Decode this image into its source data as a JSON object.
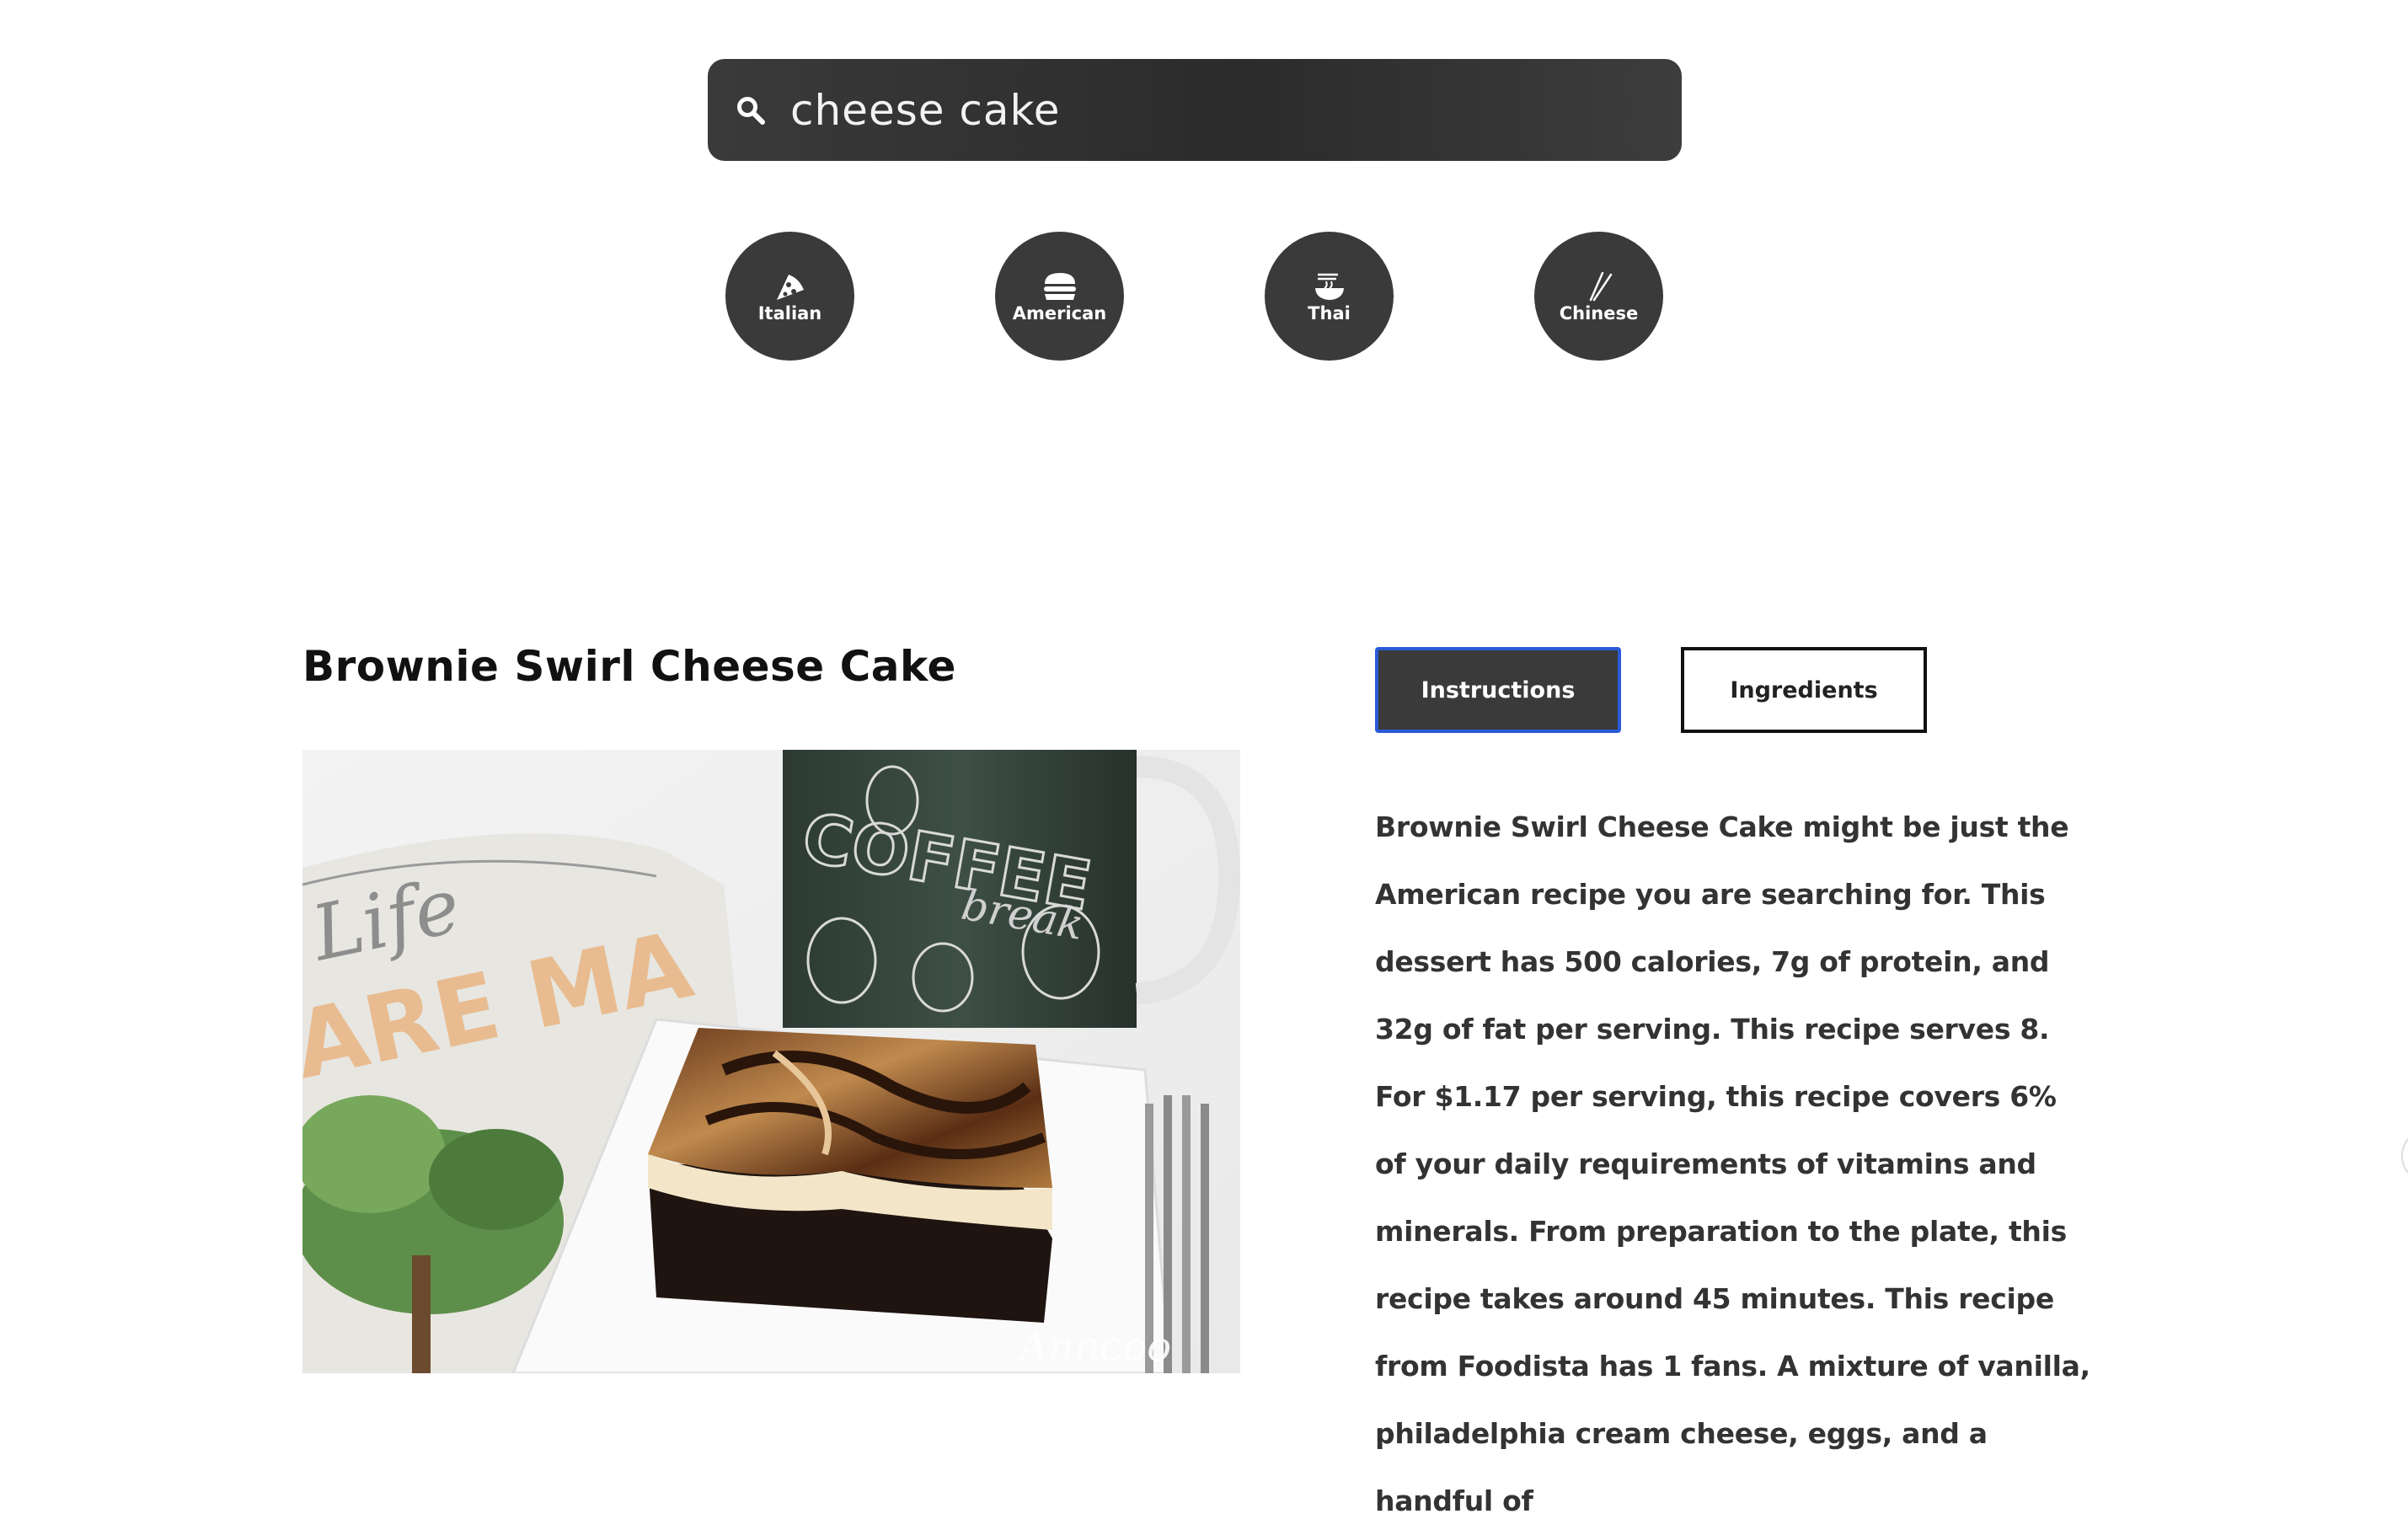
{
  "search": {
    "value": "cheese cake",
    "icon": "search-icon"
  },
  "cuisines": [
    {
      "label": "Italian",
      "icon": "pizza-icon"
    },
    {
      "label": "American",
      "icon": "burger-icon"
    },
    {
      "label": "Thai",
      "icon": "noodle-bowl-icon"
    },
    {
      "label": "Chinese",
      "icon": "chopsticks-icon"
    }
  ],
  "recipe": {
    "title": "Brownie Swirl Cheese Cake",
    "image_watermark": "Anncoo",
    "tabs": {
      "instructions": "Instructions",
      "ingredients": "Ingredients"
    },
    "summary": "Brownie Swirl Cheese Cake might be just the American recipe you are searching for. This dessert has 500 calories, 7g of protein, and 32g of fat per serving. This recipe serves 8. For $1.17 per serving, this recipe covers 6% of your daily requirements of vitamins and minerals. From preparation to the plate, this recipe takes around 45 minutes. This recipe from Foodista has 1 fans. A mixture of vanilla, philadelphia cream cheese, eggs, and a handful of"
  },
  "colors": {
    "dark": "#3a3a3a",
    "active_border": "#2a5bd6",
    "text": "#333333"
  }
}
